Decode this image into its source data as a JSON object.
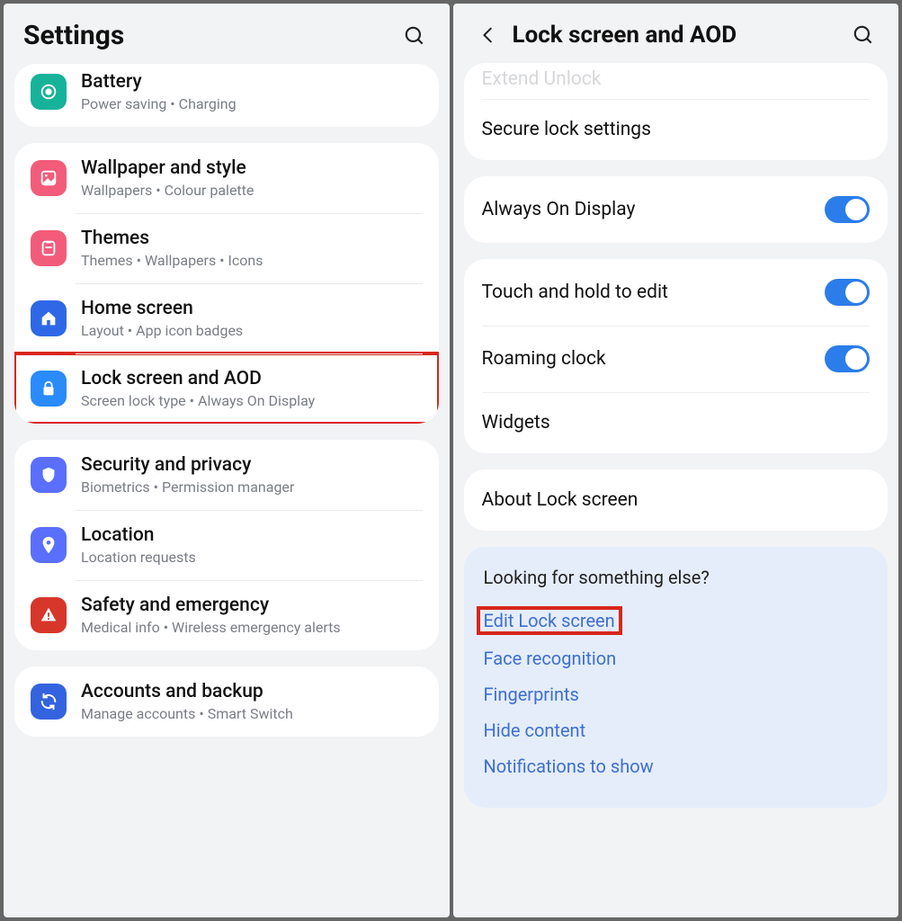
{
  "left": {
    "header_title": "Settings",
    "groups": [
      {
        "items": [
          {
            "key": "battery",
            "title": "Battery",
            "sub": "Power saving  •  Charging",
            "icon": "battery-icon",
            "bg": "#17b29a",
            "fg": "#ffffff",
            "partial": true
          }
        ]
      },
      {
        "items": [
          {
            "key": "wallpaper",
            "title": "Wallpaper and style",
            "sub": "Wallpapers  •  Colour palette",
            "icon": "wallpaper-icon",
            "bg": "#f25c7a",
            "fg": "#ffffff"
          },
          {
            "key": "themes",
            "title": "Themes",
            "sub": "Themes  •  Wallpapers  •  Icons",
            "icon": "themes-icon",
            "bg": "#f25c7a",
            "fg": "#ffffff"
          },
          {
            "key": "home",
            "title": "Home screen",
            "sub": "Layout  •  App icon badges",
            "icon": "home-icon",
            "bg": "#2f68e6",
            "fg": "#ffffff"
          },
          {
            "key": "lock",
            "title": "Lock screen and AOD",
            "sub": "Screen lock type  •  Always On Display",
            "icon": "lock-icon",
            "bg": "#2a8bff",
            "fg": "#ffffff",
            "highlight": true
          }
        ]
      },
      {
        "items": [
          {
            "key": "security",
            "title": "Security and privacy",
            "sub": "Biometrics  •  Permission manager",
            "icon": "shield-icon",
            "bg": "#5a6fff",
            "fg": "#ffffff"
          },
          {
            "key": "location",
            "title": "Location",
            "sub": "Location requests",
            "icon": "location-icon",
            "bg": "#5a6fff",
            "fg": "#ffffff"
          },
          {
            "key": "safety",
            "title": "Safety and emergency",
            "sub": "Medical info  •  Wireless emergency alerts",
            "icon": "warning-icon",
            "bg": "#d7362b",
            "fg": "#ffffff"
          }
        ]
      },
      {
        "items": [
          {
            "key": "accounts",
            "title": "Accounts and backup",
            "sub": "Manage accounts  •  Smart Switch",
            "icon": "sync-icon",
            "bg": "#3463e0",
            "fg": "#ffffff"
          }
        ]
      }
    ]
  },
  "right": {
    "header_title": "Lock screen and AOD",
    "groups": [
      {
        "rows": [
          {
            "key": "extend",
            "label": "Extend Unlock",
            "partial_top": true
          },
          {
            "key": "secure",
            "label": "Secure lock settings"
          }
        ]
      },
      {
        "rows": [
          {
            "key": "aod",
            "label": "Always On Display",
            "toggle": true,
            "on": true
          }
        ]
      },
      {
        "rows": [
          {
            "key": "touchhold",
            "label": "Touch and hold to edit",
            "toggle": true,
            "on": true
          },
          {
            "key": "roaming",
            "label": "Roaming clock",
            "toggle": true,
            "on": true
          },
          {
            "key": "widgets",
            "label": "Widgets"
          }
        ]
      },
      {
        "rows": [
          {
            "key": "about",
            "label": "About Lock screen"
          }
        ]
      }
    ],
    "extra": {
      "heading": "Looking for something else?",
      "links": [
        {
          "key": "editlock",
          "label": "Edit Lock screen",
          "highlight": true
        },
        {
          "key": "face",
          "label": "Face recognition"
        },
        {
          "key": "finger",
          "label": "Fingerprints"
        },
        {
          "key": "hide",
          "label": "Hide content"
        },
        {
          "key": "notif",
          "label": "Notifications to show"
        }
      ]
    }
  }
}
